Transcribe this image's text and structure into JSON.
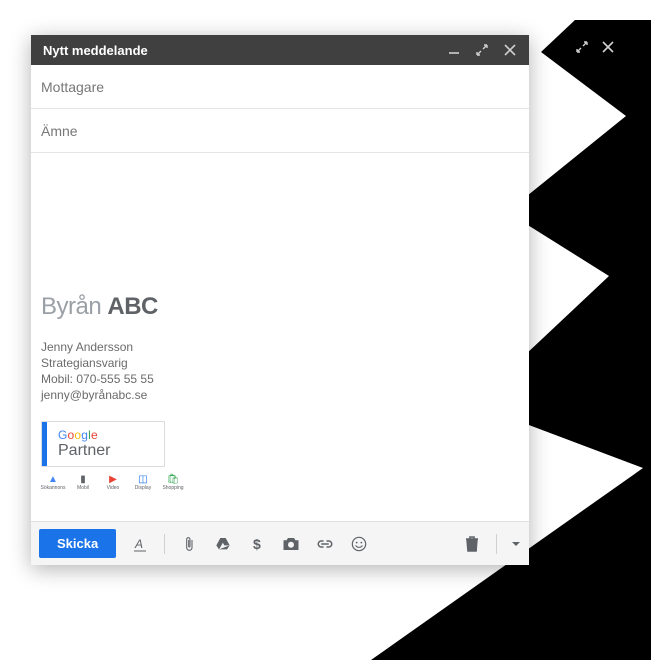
{
  "bg_window": {
    "controls": {
      "expand_icon": "expand-icon",
      "close_icon": "close-icon"
    }
  },
  "compose": {
    "title": "Nytt meddelande",
    "controls": {
      "minimize_icon": "minimize-icon",
      "expand_icon": "expand-icon",
      "close_icon": "close-icon"
    },
    "recipients": {
      "placeholder": "Mottagare",
      "value": ""
    },
    "subject": {
      "placeholder": "Ämne",
      "value": ""
    },
    "body": "",
    "signature": {
      "company_prefix": "Byrån",
      "company_bold": "ABC",
      "name": "Jenny Andersson",
      "role": "Strategiansvarig",
      "phone": "Mobil: 070-555 55 55",
      "email": "jenny@byrånabc.se",
      "badge": {
        "line1": "Google",
        "line2": "Partner",
        "specializations": [
          "Sökannons",
          "Mobil",
          "Video",
          "Display",
          "Shopping"
        ]
      }
    },
    "toolbar": {
      "send_label": "Skicka",
      "format_icon": "format-underline-a-icon",
      "attach_icon": "attachment-icon",
      "drive_icon": "drive-icon",
      "money_icon": "dollar-icon",
      "photo_icon": "camera-icon",
      "link_icon": "link-icon",
      "emoji_icon": "emoji-icon",
      "discard_icon": "trash-icon",
      "more_icon": "caret-down-icon"
    }
  }
}
